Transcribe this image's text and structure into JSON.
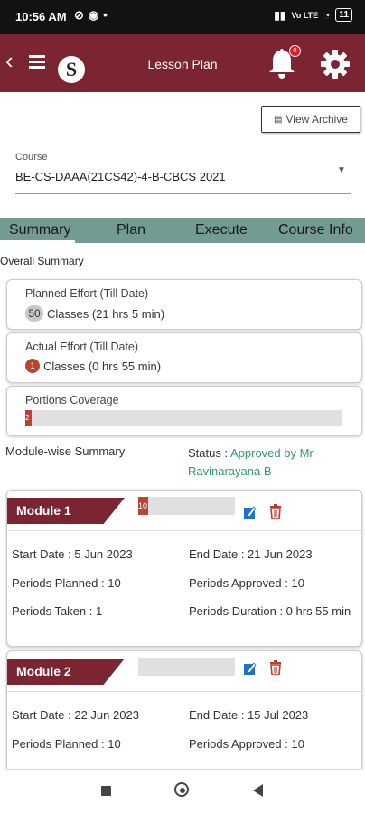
{
  "status_bar": {
    "time": "10:56 AM",
    "battery": "11"
  },
  "app_bar": {
    "title": "Lesson Plan",
    "logo_letter": "S",
    "notification_count": "0"
  },
  "archive_button": {
    "label": "View Archive"
  },
  "course": {
    "label": "Course",
    "value": "BE-CS-DAAA(21CS42)-4-B-CBCS 2021"
  },
  "tabs": [
    {
      "label": "Summary"
    },
    {
      "label": "Plan"
    },
    {
      "label": "Execute"
    },
    {
      "label": "Course Info"
    }
  ],
  "overall_summary": {
    "title": "Overall Summary"
  },
  "planned_effort": {
    "title": "Planned Effort (Till Date)",
    "count": "50",
    "text": "Classes (21 hrs 5 min)"
  },
  "actual_effort": {
    "title": "Actual Effort (Till Date)",
    "count": "1",
    "text": "Classes (0 hrs 55 min)"
  },
  "portions": {
    "title": "Portions Coverage",
    "percent": 2,
    "label": "2"
  },
  "module_summary": {
    "title": "Module-wise Summary",
    "status_label": "Status : ",
    "status_value": "Approved by Mr Ravinarayana B"
  },
  "modules": [
    {
      "title": "Module 1",
      "progress": 10,
      "progress_label": "10",
      "start_date": "Start Date : 5 Jun 2023",
      "end_date": "End Date : 21 Jun 2023",
      "periods_planned": "Periods Planned : 10",
      "periods_approved": "Periods Approved : 10",
      "periods_taken": "Periods Taken : 1",
      "periods_duration": "Periods Duration : 0 hrs 55 min"
    },
    {
      "title": "Module 2",
      "progress": 0,
      "progress_label": "",
      "start_date": "Start Date : 22 Jun 2023",
      "end_date": "End Date : 15 Jul 2023",
      "periods_planned": "Periods Planned : 10",
      "periods_approved": "Periods Approved : 10"
    }
  ],
  "colors": {
    "brand": "#7b2532",
    "tab_bar": "#739b93",
    "status_ok": "#2e9a6c",
    "progress": "#b8452f"
  }
}
